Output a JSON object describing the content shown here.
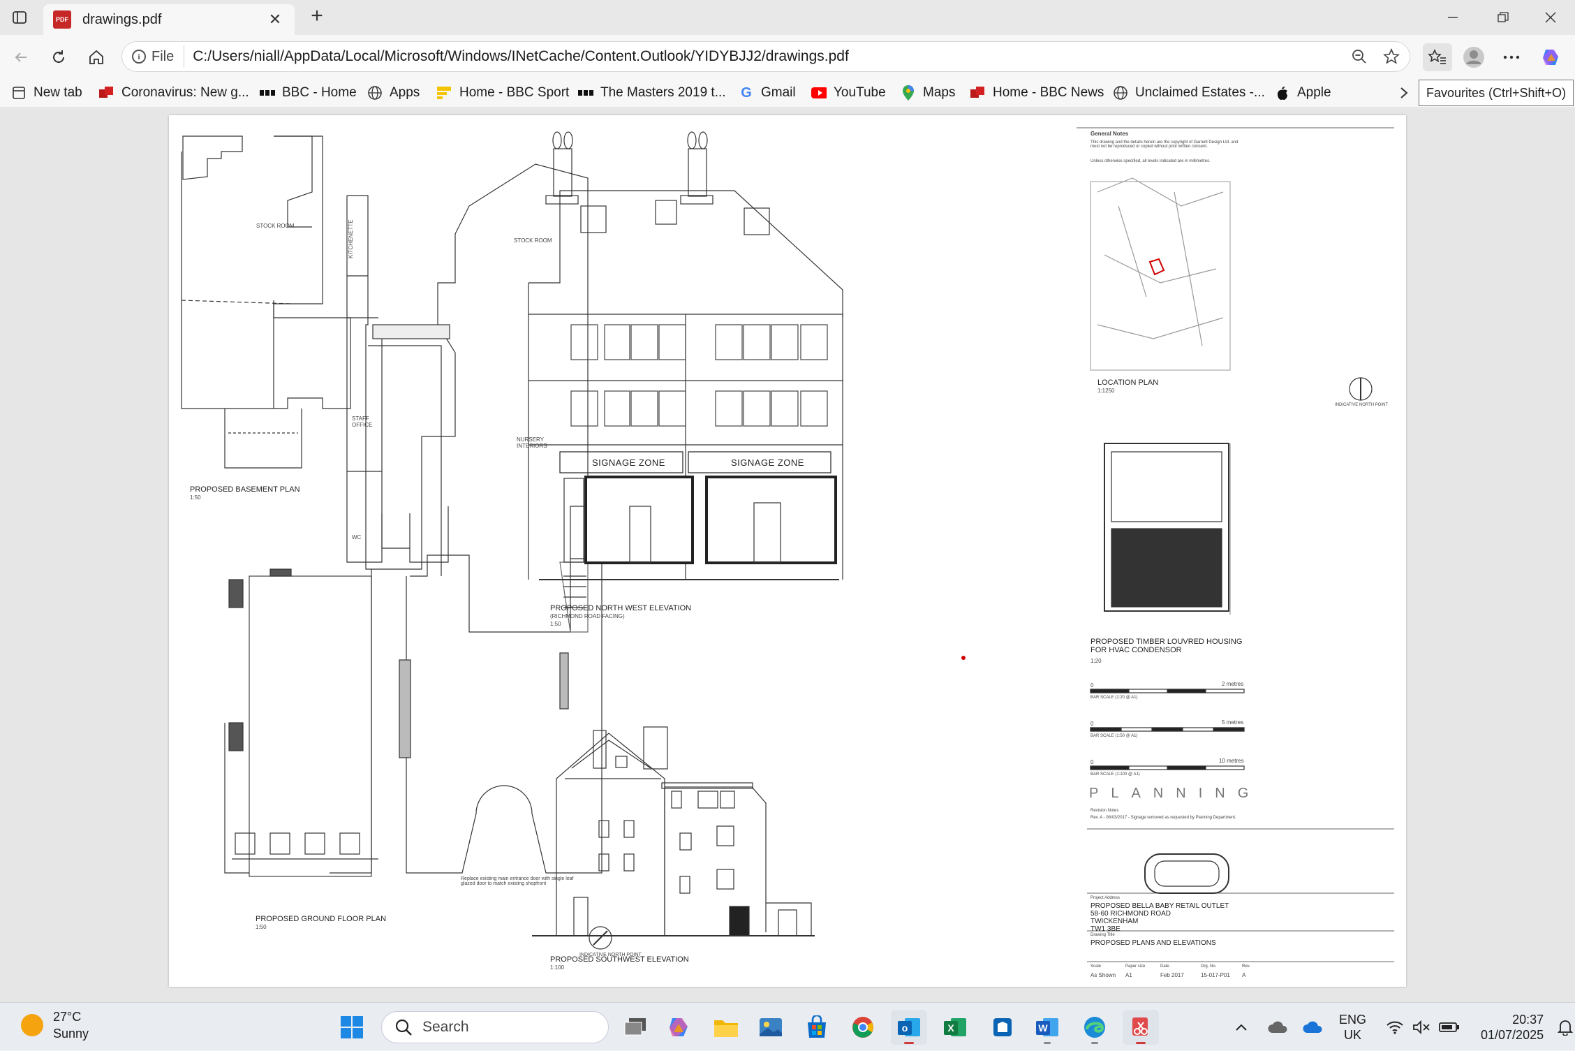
{
  "browser": {
    "tab": {
      "title": "drawings.pdf",
      "icon": "pdf-icon"
    },
    "address": {
      "site_chip": "File",
      "url": "C:/Users/niall/AppData/Local/Microsoft/Windows/INetCache/Content.Outlook/YIDYBJJ2/drawings.pdf"
    },
    "favourites": [
      {
        "label": "New tab",
        "icon": "new-tab-icon"
      },
      {
        "label": "Coronavirus: New g...",
        "icon": "bbc-news-icon"
      },
      {
        "label": "BBC - Home",
        "icon": "bbc-icon"
      },
      {
        "label": "Apps",
        "icon": "globe-icon"
      },
      {
        "label": "Home - BBC Sport",
        "icon": "bbc-sport-icon"
      },
      {
        "label": "The Masters 2019 t...",
        "icon": "bbc-icon"
      },
      {
        "label": "Gmail",
        "icon": "google-icon"
      },
      {
        "label": "YouTube",
        "icon": "youtube-icon"
      },
      {
        "label": "Maps",
        "icon": "maps-pin-icon"
      },
      {
        "label": "Home - BBC News",
        "icon": "bbc-news-icon"
      },
      {
        "label": "Unclaimed Estates -...",
        "icon": "globe-icon"
      },
      {
        "label": "Apple",
        "icon": "apple-icon"
      }
    ],
    "tooltip": "Favourites (Ctrl+Shift+O)"
  },
  "drawing": {
    "basement": {
      "title": "PROPOSED BASEMENT PLAN",
      "scale": "1:50",
      "room": "STOCK ROOM"
    },
    "ground": {
      "title": "PROPOSED GROUND FLOOR PLAN",
      "scale": "1:50",
      "rooms": [
        "KITCHENETTE",
        "STOCK ROOM",
        "STAFF OFFICE",
        "NURSERY INTERIORS",
        "WC"
      ],
      "entrance_note": "Replace existing main entrance door with single leaf glazed door to match existing shopfront",
      "north": "INDICATIVE NORTH POINT"
    },
    "nw_elevation": {
      "title": "PROPOSED NORTH WEST ELEVATION",
      "subtitle": "(RICHMOND ROAD FACING)",
      "scale": "1:50",
      "zone_left": "SIGNAGE ZONE",
      "zone_right": "SIGNAGE ZONE"
    },
    "sw_elevation": {
      "title": "PROPOSED SOUTHWEST ELEVATION",
      "scale": "1:100"
    },
    "notes": {
      "heading": "General Notes",
      "line1": "This drawing and the details herein are the copyright of Garnett Design Ltd. and must not be reproduced or copied without prior written consent.",
      "line2": "Unless otherwise specified, all levels indicated are in millimetres."
    },
    "location": {
      "title": "LOCATION PLAN",
      "scale": "1:1250",
      "north": "INDICATIVE NORTH POINT"
    },
    "louvre": {
      "title": "PROPOSED TIMBER LOUVRED HOUSING FOR HVAC CONDENSOR",
      "scale": "1:20"
    },
    "bars": [
      {
        "end": "2 metres",
        "label": "BAR SCALE (1:20 @ A1)"
      },
      {
        "end": "5 metres",
        "label": "BAR SCALE (1:50 @ A1)"
      },
      {
        "end": "10 metres",
        "label": "BAR SCALE (1:100 @ A1)"
      }
    ],
    "planning": "PLANNING",
    "revision": {
      "heading": "Revision Notes",
      "text": "Rev. A - 06/03/2017 - Signage removed as requested by Planning Department."
    },
    "project": {
      "label": "Project Address",
      "line1": "PROPOSED BELLA BABY RETAIL OUTLET",
      "line2": "58-60 RICHMOND ROAD",
      "line3": "TWICKENHAM",
      "line4": "TW1 3BE"
    },
    "drawing_title": {
      "label": "Drawing Title",
      "value": "PROPOSED PLANS AND ELEVATIONS"
    },
    "table": {
      "headers": [
        "Scale",
        "Paper size",
        "Date",
        "Drg. No.",
        "Rev."
      ],
      "values": [
        "As Shown",
        "A1",
        "Feb 2017",
        "15-017-P01",
        "A"
      ]
    }
  },
  "taskbar": {
    "weather": {
      "temp": "27°C",
      "condition": "Sunny"
    },
    "search_placeholder": "Search",
    "language": {
      "line1": "ENG",
      "line2": "UK"
    },
    "clock": {
      "time": "20:37",
      "date": "01/07/2025"
    }
  }
}
